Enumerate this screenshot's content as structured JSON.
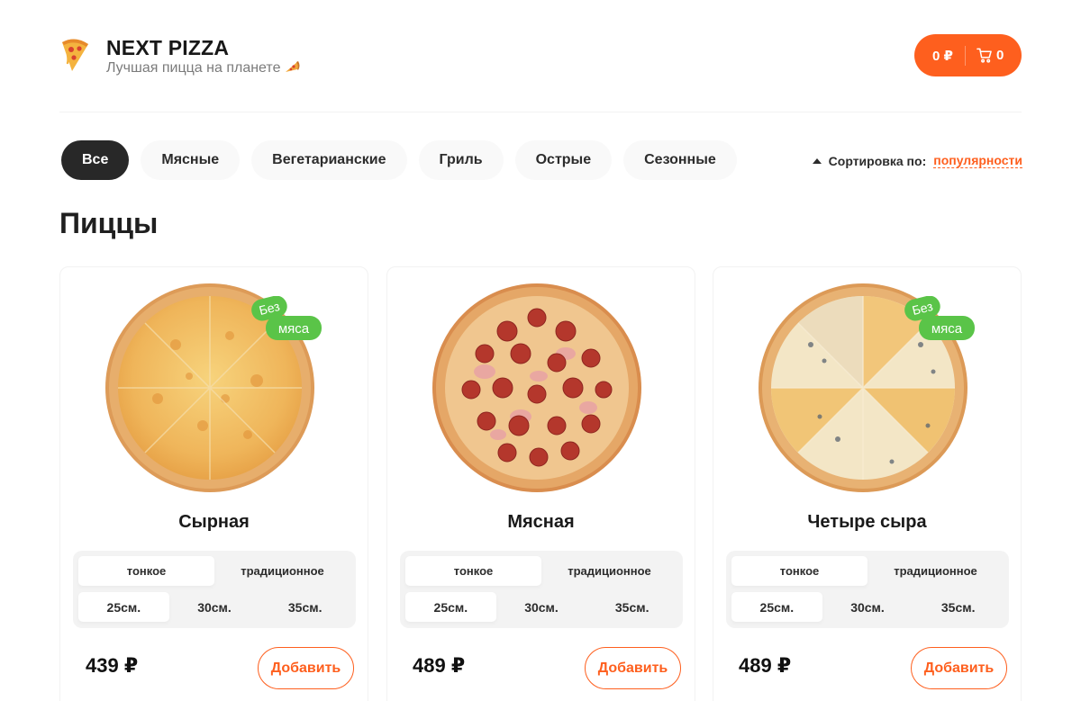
{
  "brand": {
    "title": "NEXT PIZZA",
    "subtitle": "Лучшая пицца на планете"
  },
  "cart": {
    "total": "0 ₽",
    "count": "0"
  },
  "categories": [
    "Все",
    "Мясные",
    "Вегетарианские",
    "Гриль",
    "Острые",
    "Сезонные"
  ],
  "active_category": "Все",
  "sort": {
    "label": "Сортировка по:",
    "value": "популярности"
  },
  "section_title": "Пиццы",
  "pizzas": [
    {
      "name": "Сырная",
      "badge": [
        "Без",
        "мяса"
      ],
      "types": [
        "тонкое",
        "традиционное"
      ],
      "active_type": "тонкое",
      "sizes": [
        "25см.",
        "30см.",
        "35см."
      ],
      "active_size": "25см.",
      "price": "439 ₽",
      "add_label": "Добавить"
    },
    {
      "name": "Мясная",
      "badge": null,
      "types": [
        "тонкое",
        "традиционное"
      ],
      "active_type": "тонкое",
      "sizes": [
        "25см.",
        "30см.",
        "35см."
      ],
      "active_size": "25см.",
      "price": "489 ₽",
      "add_label": "Добавить"
    },
    {
      "name": "Четыре сыра",
      "badge": [
        "Без",
        "мяса"
      ],
      "types": [
        "тонкое",
        "традиционное"
      ],
      "active_type": "тонкое",
      "sizes": [
        "25см.",
        "30см.",
        "35см."
      ],
      "active_size": "25см.",
      "price": "489 ₽",
      "add_label": "Добавить"
    }
  ],
  "colors": {
    "accent": "#fe5f1e",
    "badge_green": "#5ac448",
    "active_category_bg": "#282828"
  },
  "icons": {
    "logo": "pizza-slice-icon",
    "cart": "cart-icon",
    "sort": "triangle-up-icon"
  }
}
